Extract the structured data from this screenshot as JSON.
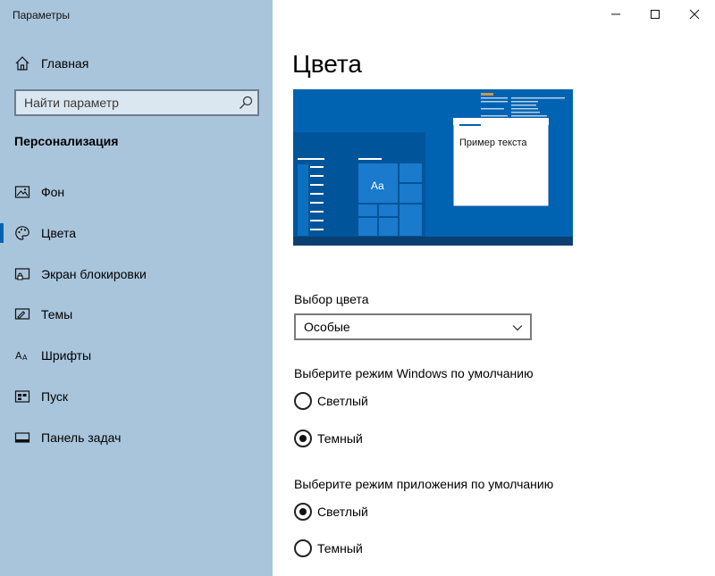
{
  "window": {
    "title": "Параметры",
    "controls": [
      "minimize",
      "maximize",
      "close"
    ]
  },
  "sidebar": {
    "home_label": "Главная",
    "search_placeholder": "Найти параметр",
    "section_heading": "Персонализация",
    "items": [
      {
        "label": "Фон",
        "icon": "image-icon",
        "selected": false
      },
      {
        "label": "Цвета",
        "icon": "palette-icon",
        "selected": true
      },
      {
        "label": "Экран блокировки",
        "icon": "lock-screen-icon",
        "selected": false
      },
      {
        "label": "Темы",
        "icon": "themes-icon",
        "selected": false
      },
      {
        "label": "Шрифты",
        "icon": "fonts-icon",
        "selected": false
      },
      {
        "label": "Пуск",
        "icon": "start-icon",
        "selected": false
      },
      {
        "label": "Панель задач",
        "icon": "taskbar-icon",
        "selected": false
      }
    ]
  },
  "main": {
    "page_title": "Цвета",
    "preview": {
      "sample_text": "Пример текста",
      "tile_text": "Aa",
      "accent_color": "#0063b1"
    },
    "color_choice": {
      "label": "Выбор цвета",
      "value": "Особые"
    },
    "windows_mode": {
      "label": "Выберите режим Windows по умолчанию",
      "options": [
        {
          "label": "Светлый",
          "checked": false
        },
        {
          "label": "Темный",
          "checked": true
        }
      ]
    },
    "app_mode": {
      "label": "Выберите режим приложения по умолчанию",
      "options": [
        {
          "label": "Светлый",
          "checked": true
        },
        {
          "label": "Темный",
          "checked": false
        }
      ]
    }
  },
  "colors": {
    "sidebar_bg": "#a9c5dc",
    "accent": "#0063b1",
    "content_bg": "#ffffff"
  }
}
